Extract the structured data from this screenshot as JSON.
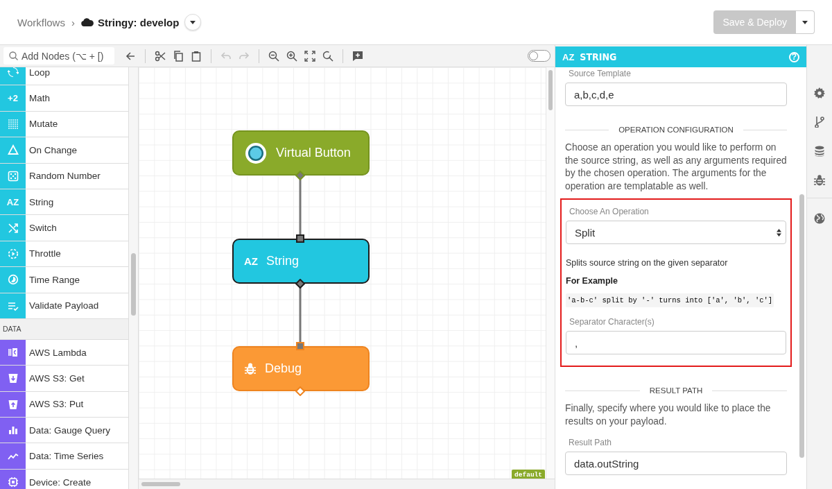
{
  "header": {
    "breadcrumb": "Workflows",
    "separator": "›",
    "title": "Stringy: develop",
    "save_button": {
      "label": "Save & Deploy",
      "disabled": true
    }
  },
  "toolbar": {
    "search_placeholder": "Add Nodes (⌥ + [)",
    "undo": {
      "disabled": true
    },
    "redo": {
      "disabled": true
    },
    "toggle": {
      "on": false
    }
  },
  "palette": {
    "sections": [
      {
        "items": [
          {
            "label": "Loop",
            "color": "#22c7e0"
          },
          {
            "label": "Math",
            "color": "#22c7e0",
            "icon_text": "+2"
          },
          {
            "label": "Mutate",
            "color": "#22c7e0"
          },
          {
            "label": "On Change",
            "color": "#22c7e0"
          },
          {
            "label": "Random Number",
            "color": "#22c7e0"
          },
          {
            "label": "String",
            "color": "#22c7e0",
            "icon_text": "AZ"
          },
          {
            "label": "Switch",
            "color": "#22c7e0"
          },
          {
            "label": "Throttle",
            "color": "#22c7e0"
          },
          {
            "label": "Time Range",
            "color": "#22c7e0"
          },
          {
            "label": "Validate Payload",
            "color": "#22c7e0"
          }
        ]
      },
      {
        "title": "DATA",
        "items": [
          {
            "label": "AWS Lambda",
            "color": "#8060f2"
          },
          {
            "label": "AWS S3: Get",
            "color": "#8060f2"
          },
          {
            "label": "AWS S3: Put",
            "color": "#8060f2"
          },
          {
            "label": "Data: Gauge Query",
            "color": "#8060f2"
          },
          {
            "label": "Data: Time Series",
            "color": "#8060f2"
          },
          {
            "label": "Device: Create",
            "color": "#8060f2"
          }
        ]
      }
    ]
  },
  "canvas": {
    "nodes": [
      {
        "label": "Virtual Button",
        "kind": "trigger",
        "selected": false
      },
      {
        "label": "String",
        "kind": "logic",
        "selected": true,
        "icon_text": "AZ"
      },
      {
        "label": "Debug",
        "kind": "output",
        "selected": false
      }
    ],
    "badge": "default"
  },
  "panel": {
    "title": "STRING",
    "icon_text": "AZ",
    "help": "?",
    "blocks": [
      {
        "kind": "field",
        "label": "Source Template",
        "value": "a,b,c,d,e"
      },
      {
        "kind": "heading",
        "text": "OPERATION CONFIGURATION"
      },
      {
        "kind": "paragraph",
        "text": "Choose an operation you would like to perform on the source string, as well as any arguments required by the chosen operation. The arguments for the operation are templatable as well."
      },
      {
        "kind": "group",
        "highlighted": true,
        "blocks": [
          {
            "kind": "select",
            "label": "Choose An Operation",
            "value": "Split"
          },
          {
            "kind": "note",
            "text": "Splits source string on the given separator"
          },
          {
            "kind": "subheading",
            "text": "For Example"
          },
          {
            "kind": "code",
            "text": "'a-b-c' split by '-' turns into ['a', 'b', 'c']"
          },
          {
            "kind": "field",
            "label": "Separator Character(s)",
            "value": ","
          }
        ]
      },
      {
        "kind": "heading",
        "text": "RESULT PATH"
      },
      {
        "kind": "paragraph",
        "text": "Finally, specify where you would like to place the results on your payload."
      },
      {
        "kind": "field",
        "label": "Result Path",
        "value": "data.outString"
      }
    ]
  }
}
